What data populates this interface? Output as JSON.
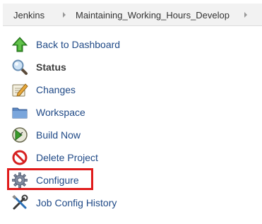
{
  "breadcrumb": {
    "items": [
      {
        "label": "Jenkins"
      },
      {
        "label": "Maintaining_Working_Hours_Develop"
      }
    ]
  },
  "sidebar": {
    "items": [
      {
        "label": "Back to Dashboard",
        "icon": "up-arrow-icon"
      },
      {
        "label": "Status",
        "icon": "magnifier-icon",
        "active": true
      },
      {
        "label": "Changes",
        "icon": "notepad-icon"
      },
      {
        "label": "Workspace",
        "icon": "folder-icon"
      },
      {
        "label": "Build Now",
        "icon": "clock-play-icon"
      },
      {
        "label": "Delete Project",
        "icon": "no-entry-icon"
      },
      {
        "label": "Configure",
        "icon": "gear-icon",
        "highlighted": true
      },
      {
        "label": "Job Config History",
        "icon": "tools-icon"
      }
    ]
  },
  "colors": {
    "link": "#204a87",
    "highlight_border": "#e01b1b",
    "breadcrumb_bg": "#f2f2f2"
  }
}
